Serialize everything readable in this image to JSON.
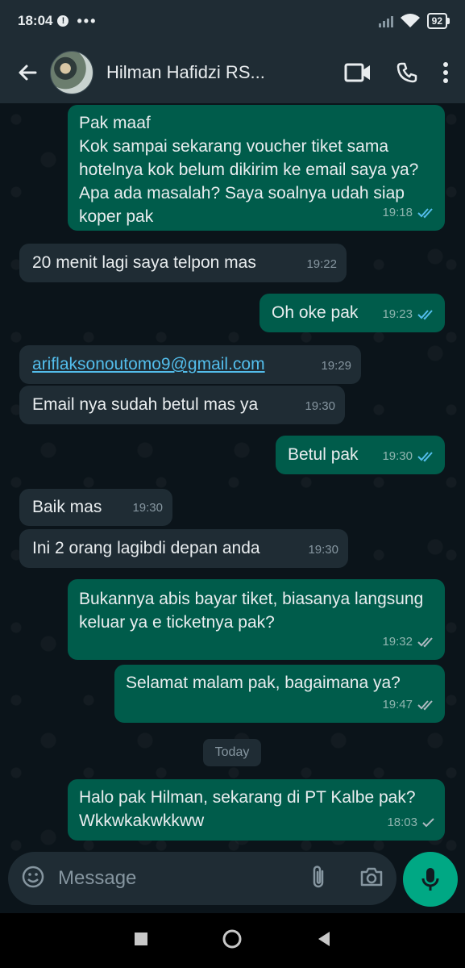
{
  "status_bar": {
    "time": "18:04",
    "battery": "92"
  },
  "header": {
    "contact_name": "Hilman Hafidzi RS..."
  },
  "messages": [
    {
      "text": "Pak maaf\nKok sampai sekarang voucher tiket sama hotelnya kok belum dikirim ke email saya ya? Apa ada masalah? Saya soalnya udah siap koper pak",
      "time": "19:18",
      "status": "read"
    },
    {
      "text": "20 menit lagi saya telpon mas",
      "time": "19:22"
    },
    {
      "text": "Oh oke pak",
      "time": "19:23",
      "status": "read"
    },
    {
      "text": "ariflaksonoutomo9@gmail.com",
      "time": "19:29"
    },
    {
      "text": "Email nya sudah betul mas ya",
      "time": "19:30"
    },
    {
      "text": "Betul pak",
      "time": "19:30",
      "status": "read"
    },
    {
      "text": "Baik mas",
      "time": "19:30"
    },
    {
      "text": "Ini 2 orang lagibdi depan anda",
      "time": "19:30"
    },
    {
      "text": "Bukannya abis bayar tiket, biasanya langsung keluar ya e ticketnya pak?",
      "time": "19:32",
      "status": "delivered"
    },
    {
      "text": "Selamat malam pak, bagaimana ya?",
      "time": "19:47",
      "status": "delivered"
    },
    {
      "text": "Halo pak Hilman, sekarang di PT Kalbe pak? Wkkwkakwkkww",
      "time": "18:03",
      "status": "sent"
    }
  ],
  "date_separator": "Today",
  "composer": {
    "placeholder": "Message"
  },
  "colors": {
    "outgoing_bubble": "#005c4b",
    "incoming_bubble": "#1f2c34",
    "accent": "#00a884",
    "read_tick": "#53bdeb"
  }
}
